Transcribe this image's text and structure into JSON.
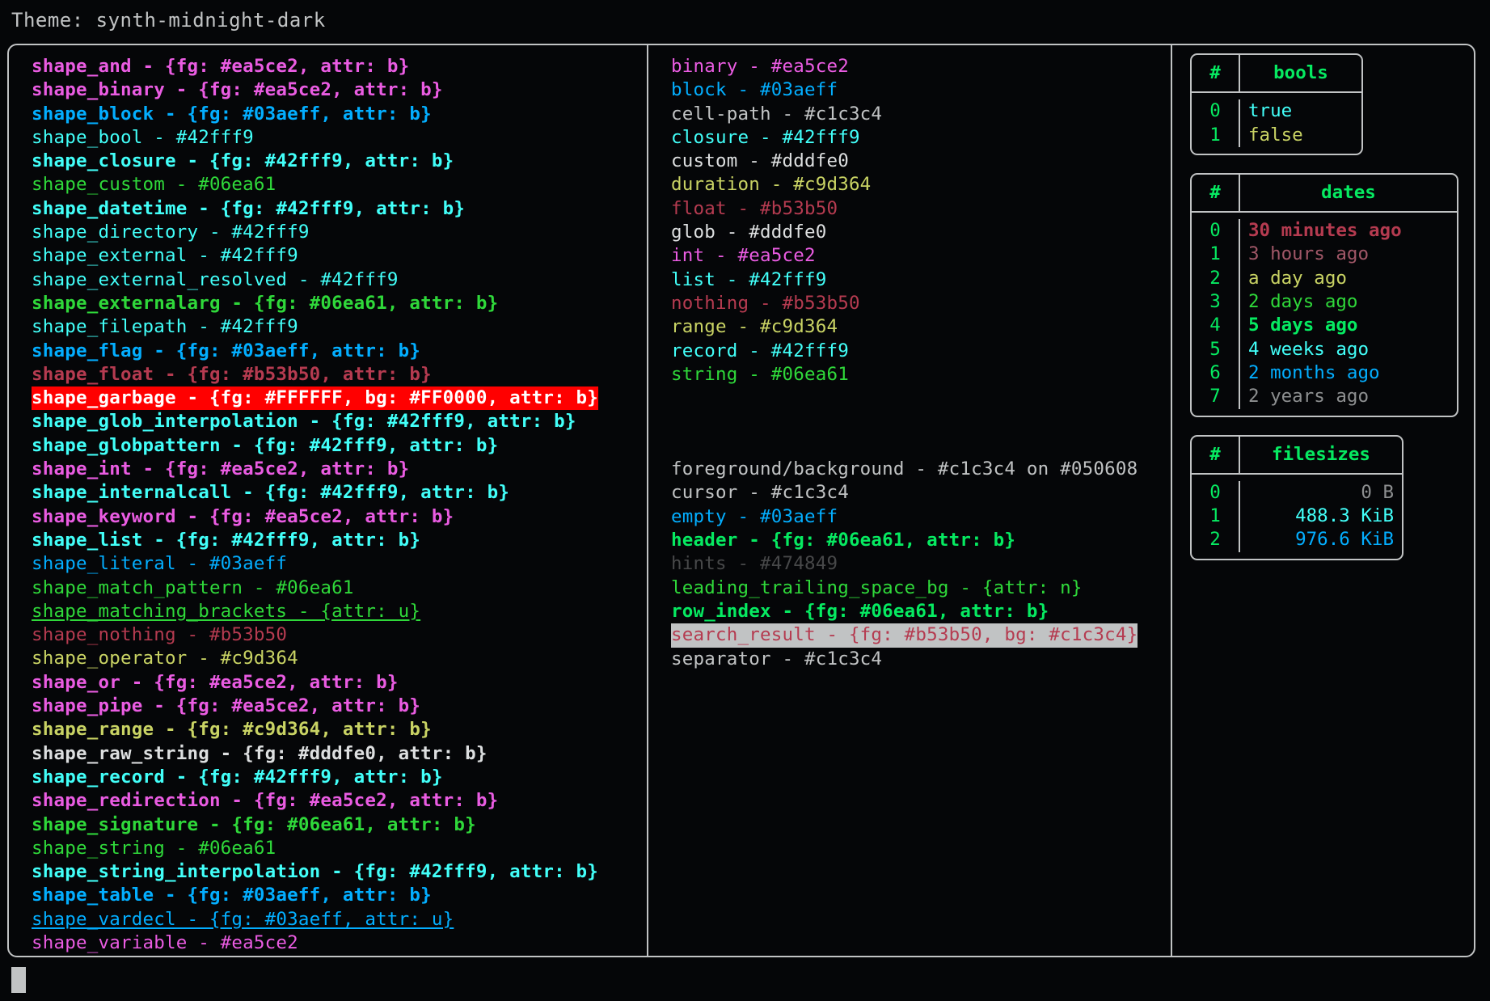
{
  "header": {
    "label": "Theme: synth-midnight-dark"
  },
  "palette": {
    "background": "#050608",
    "foreground": "#c1c3c4",
    "border": "#c1c3c4",
    "magenta": "#ea5ce2",
    "blue": "#03aeff",
    "cyan": "#42fff9",
    "green": "#06ea61",
    "bright_green": "#2fd83a",
    "red": "#b53b50",
    "yellow": "#c9d364",
    "white": "#dddfe0",
    "gray": "#474849",
    "alert_fg": "#FFFFFF",
    "alert_bg": "#FF0000",
    "search_bg": "#c1c3c4"
  },
  "shapes_column": [
    {
      "text": "shape_and - {fg: #ea5ce2, attr: b}",
      "color": "#ea5ce2",
      "bold": true,
      "underline": false
    },
    {
      "text": "shape_binary - {fg: #ea5ce2, attr: b}",
      "color": "#ea5ce2",
      "bold": true,
      "underline": false
    },
    {
      "text": "shape_block - {fg: #03aeff, attr: b}",
      "color": "#03aeff",
      "bold": true,
      "underline": false
    },
    {
      "text": "shape_bool - #42fff9",
      "color": "#42fff9",
      "bold": false,
      "underline": false
    },
    {
      "text": "shape_closure - {fg: #42fff9, attr: b}",
      "color": "#42fff9",
      "bold": true,
      "underline": false
    },
    {
      "text": "shape_custom - #06ea61",
      "color": "#2fd83a",
      "bold": false,
      "underline": false
    },
    {
      "text": "shape_datetime - {fg: #42fff9, attr: b}",
      "color": "#42fff9",
      "bold": true,
      "underline": false
    },
    {
      "text": "shape_directory - #42fff9",
      "color": "#42fff9",
      "bold": false,
      "underline": false
    },
    {
      "text": "shape_external - #42fff9",
      "color": "#42fff9",
      "bold": false,
      "underline": false
    },
    {
      "text": "shape_external_resolved - #42fff9",
      "color": "#42fff9",
      "bold": false,
      "underline": false
    },
    {
      "text": "shape_externalarg - {fg: #06ea61, attr: b}",
      "color": "#2fd83a",
      "bold": true,
      "underline": false
    },
    {
      "text": "shape_filepath - #42fff9",
      "color": "#42fff9",
      "bold": false,
      "underline": false
    },
    {
      "text": "shape_flag - {fg: #03aeff, attr: b}",
      "color": "#03aeff",
      "bold": true,
      "underline": false
    },
    {
      "text": "shape_float - {fg: #b53b50, attr: b}",
      "color": "#b53b50",
      "bold": true,
      "underline": false
    },
    {
      "text": "shape_garbage - {fg: #FFFFFF, bg: #FF0000, attr: b}",
      "color": "#FFFFFF",
      "background": "#FF0000",
      "bold": true,
      "underline": false
    },
    {
      "text": "shape_glob_interpolation - {fg: #42fff9, attr: b}",
      "color": "#42fff9",
      "bold": true,
      "underline": false
    },
    {
      "text": "shape_globpattern - {fg: #42fff9, attr: b}",
      "color": "#42fff9",
      "bold": true,
      "underline": false
    },
    {
      "text": "shape_int - {fg: #ea5ce2, attr: b}",
      "color": "#ea5ce2",
      "bold": true,
      "underline": false
    },
    {
      "text": "shape_internalcall - {fg: #42fff9, attr: b}",
      "color": "#42fff9",
      "bold": true,
      "underline": false
    },
    {
      "text": "shape_keyword - {fg: #ea5ce2, attr: b}",
      "color": "#ea5ce2",
      "bold": true,
      "underline": false
    },
    {
      "text": "shape_list - {fg: #42fff9, attr: b}",
      "color": "#42fff9",
      "bold": true,
      "underline": false
    },
    {
      "text": "shape_literal - #03aeff",
      "color": "#03aeff",
      "bold": false,
      "underline": false
    },
    {
      "text": "shape_match_pattern - #06ea61",
      "color": "#2fd83a",
      "bold": false,
      "underline": false
    },
    {
      "text": "shape_matching_brackets - {attr: u}",
      "color": "#2fd83a",
      "bold": false,
      "underline": true
    },
    {
      "text": "shape_nothing - #b53b50",
      "color": "#b53b50",
      "bold": false,
      "underline": false
    },
    {
      "text": "shape_operator - #c9d364",
      "color": "#c9d364",
      "bold": false,
      "underline": false
    },
    {
      "text": "shape_or - {fg: #ea5ce2, attr: b}",
      "color": "#ea5ce2",
      "bold": true,
      "underline": false
    },
    {
      "text": "shape_pipe - {fg: #ea5ce2, attr: b}",
      "color": "#ea5ce2",
      "bold": true,
      "underline": false
    },
    {
      "text": "shape_range - {fg: #c9d364, attr: b}",
      "color": "#c9d364",
      "bold": true,
      "underline": false
    },
    {
      "text": "shape_raw_string - {fg: #dddfe0, attr: b}",
      "color": "#dddfe0",
      "bold": true,
      "underline": false
    },
    {
      "text": "shape_record - {fg: #42fff9, attr: b}",
      "color": "#42fff9",
      "bold": true,
      "underline": false
    },
    {
      "text": "shape_redirection - {fg: #ea5ce2, attr: b}",
      "color": "#ea5ce2",
      "bold": true,
      "underline": false
    },
    {
      "text": "shape_signature - {fg: #06ea61, attr: b}",
      "color": "#2fd83a",
      "bold": true,
      "underline": false
    },
    {
      "text": "shape_string - #06ea61",
      "color": "#2fd83a",
      "bold": false,
      "underline": false
    },
    {
      "text": "shape_string_interpolation - {fg: #42fff9, attr: b}",
      "color": "#42fff9",
      "bold": true,
      "underline": false
    },
    {
      "text": "shape_table - {fg: #03aeff, attr: b}",
      "color": "#03aeff",
      "bold": true,
      "underline": false
    },
    {
      "text": "shape_vardecl - {fg: #03aeff, attr: u}",
      "color": "#03aeff",
      "bold": false,
      "underline": true
    },
    {
      "text": "shape_variable - #ea5ce2",
      "color": "#ea5ce2",
      "bold": false,
      "underline": false
    }
  ],
  "types_column": [
    {
      "text": "binary - #ea5ce2",
      "color": "#ea5ce2",
      "bold": false,
      "underline": false
    },
    {
      "text": "block - #03aeff",
      "color": "#03aeff",
      "bold": false,
      "underline": false
    },
    {
      "text": "cell-path - #c1c3c4",
      "color": "#c1c3c4",
      "bold": false,
      "underline": false
    },
    {
      "text": "closure - #42fff9",
      "color": "#42fff9",
      "bold": false,
      "underline": false
    },
    {
      "text": "custom - #dddfe0",
      "color": "#dddfe0",
      "bold": false,
      "underline": false
    },
    {
      "text": "duration - #c9d364",
      "color": "#c9d364",
      "bold": false,
      "underline": false
    },
    {
      "text": "float - #b53b50",
      "color": "#b53b50",
      "bold": false,
      "underline": false
    },
    {
      "text": "glob - #dddfe0",
      "color": "#dddfe0",
      "bold": false,
      "underline": false
    },
    {
      "text": "int - #ea5ce2",
      "color": "#ea5ce2",
      "bold": false,
      "underline": false
    },
    {
      "text": "list - #42fff9",
      "color": "#42fff9",
      "bold": false,
      "underline": false
    },
    {
      "text": "nothing - #b53b50",
      "color": "#b53b50",
      "bold": false,
      "underline": false
    },
    {
      "text": "range - #c9d364",
      "color": "#c9d364",
      "bold": false,
      "underline": false
    },
    {
      "text": "record - #42fff9",
      "color": "#42fff9",
      "bold": false,
      "underline": false
    },
    {
      "text": "string - #06ea61",
      "color": "#2fd83a",
      "bold": false,
      "underline": false
    }
  ],
  "ui_column": [
    {
      "text": "foreground/background - #c1c3c4 on #050608",
      "color": "#c1c3c4",
      "bold": false,
      "underline": false
    },
    {
      "text": "cursor - #c1c3c4",
      "color": "#c1c3c4",
      "bold": false,
      "underline": false
    },
    {
      "text": "empty - #03aeff",
      "color": "#03aeff",
      "bold": false,
      "underline": false
    },
    {
      "text": "header - {fg: #06ea61, attr: b}",
      "color": "#06ea61",
      "bold": true,
      "underline": false
    },
    {
      "text": "hints - #474849",
      "color": "#474849",
      "bold": false,
      "underline": false
    },
    {
      "text": "leading_trailing_space_bg - {attr: n}",
      "color": "#2fd83a",
      "bold": false,
      "underline": false
    },
    {
      "text": "row_index - {fg: #06ea61, attr: b}",
      "color": "#06ea61",
      "bold": true,
      "underline": false
    },
    {
      "text": "search_result - {fg: #b53b50, bg: #c1c3c4}",
      "color": "#b53b50",
      "background": "#c1c3c4",
      "bold": false,
      "underline": false
    },
    {
      "text": "separator - #c1c3c4",
      "color": "#c1c3c4",
      "bold": false,
      "underline": false
    }
  ],
  "tables": [
    {
      "name": "bools",
      "columns": [
        "#",
        "bools"
      ],
      "rows": [
        {
          "index": "0",
          "value": "true",
          "color": "#42fff9",
          "bold": false
        },
        {
          "index": "1",
          "value": "false",
          "color": "#c9d364",
          "bold": false
        }
      ]
    },
    {
      "name": "dates",
      "columns": [
        "#",
        "dates"
      ],
      "rows": [
        {
          "index": "0",
          "value": "30 minutes ago",
          "color": "#b53b50",
          "bold": true
        },
        {
          "index": "1",
          "value": "3 hours ago",
          "color": "#a05767",
          "bold": false
        },
        {
          "index": "2",
          "value": "a day ago",
          "color": "#c9d364",
          "bold": false
        },
        {
          "index": "3",
          "value": "2 days ago",
          "color": "#2fd83a",
          "bold": false
        },
        {
          "index": "4",
          "value": "5 days ago",
          "color": "#06ea61",
          "bold": true
        },
        {
          "index": "5",
          "value": "4 weeks ago",
          "color": "#42fff9",
          "bold": false
        },
        {
          "index": "6",
          "value": "2 months ago",
          "color": "#03aeff",
          "bold": false
        },
        {
          "index": "7",
          "value": "2 years ago",
          "color": "#8d8f90",
          "bold": false
        }
      ]
    },
    {
      "name": "filesizes",
      "columns": [
        "#",
        "filesizes"
      ],
      "rows": [
        {
          "index": "0",
          "value": "0 B",
          "color": "#8d8f90",
          "bold": false
        },
        {
          "index": "1",
          "value": "488.3 KiB",
          "color": "#42fff9",
          "bold": false
        },
        {
          "index": "2",
          "value": "976.6 KiB",
          "color": "#03aeff",
          "bold": false
        }
      ]
    }
  ]
}
